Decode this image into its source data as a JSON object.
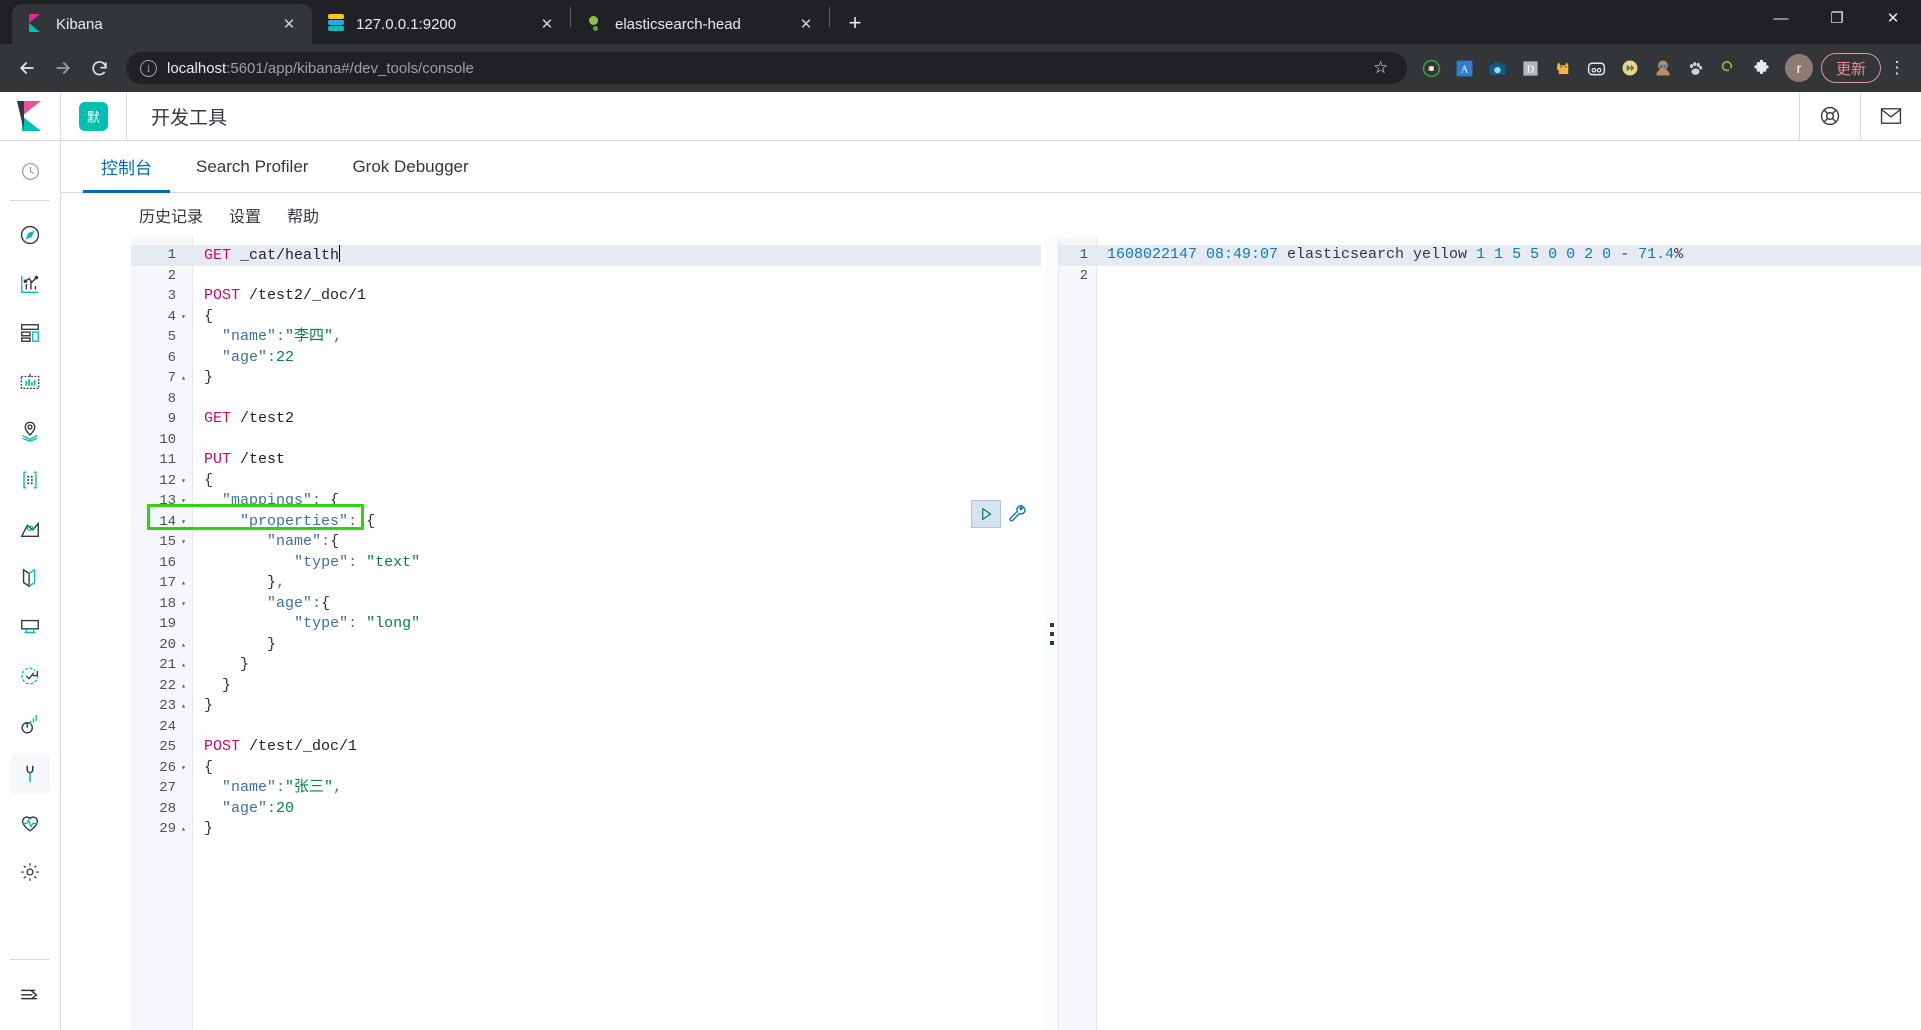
{
  "browser": {
    "tabs": [
      {
        "title": "Kibana",
        "favicon": "kibana-favicon",
        "active": true,
        "close_label": "✕"
      },
      {
        "title": "127.0.0.1:9200",
        "favicon": "elasticsearch-favicon",
        "active": false,
        "close_label": "✕"
      },
      {
        "title": "elasticsearch-head",
        "favicon": "elasticsearch-head-favicon",
        "active": false,
        "close_label": "✕"
      }
    ],
    "new_tab_label": "+",
    "window_controls": {
      "minimize": "—",
      "maximize": "❐",
      "close": "✕"
    },
    "nav": {
      "back": "←",
      "forward": "→",
      "reload": "⟳"
    },
    "omnibox": {
      "info_icon": "ⓘ",
      "url_host": "localhost",
      "url_rest": ":5601/app/kibana#/dev_tools/console",
      "star_icon": "☆"
    },
    "extensions": [
      {
        "name": "sync-extension-icon",
        "glyph": "⟳"
      },
      {
        "name": "a-translate-extension-icon",
        "glyph": "A"
      },
      {
        "name": "camera-screenshot-extension-icon",
        "glyph": "▣"
      },
      {
        "name": "d-extension-icon",
        "glyph": "D"
      },
      {
        "name": "cat-extension-icon",
        "glyph": "🐈"
      },
      {
        "name": "panda-extension-icon",
        "glyph": "◑"
      },
      {
        "name": "media-extension-icon",
        "glyph": "▷"
      },
      {
        "name": "person-extension-icon",
        "glyph": "●"
      },
      {
        "name": "paw-extension-icon",
        "glyph": "✣"
      },
      {
        "name": "magnifier-extension-icon",
        "glyph": "⚲"
      },
      {
        "name": "puzzle-extensions-icon",
        "glyph": "❖"
      }
    ],
    "profile_initial": "r",
    "update_button": "更新",
    "menu_icon": "⋮"
  },
  "kibana": {
    "logo_name": "kibana-logo",
    "space_chip": "默",
    "app_title": "开发工具",
    "header_icons": [
      {
        "name": "help-lifering-icon"
      },
      {
        "name": "mail-envelope-icon"
      }
    ],
    "nav_items": [
      {
        "name": "sidebar-item-recently-viewed",
        "icon": "clock-icon"
      },
      {
        "name": "sidebar-item-discover",
        "icon": "compass-icon"
      },
      {
        "name": "sidebar-item-visualize",
        "icon": "chart-icon"
      },
      {
        "name": "sidebar-item-dashboard",
        "icon": "dashboard-grid-icon"
      },
      {
        "name": "sidebar-item-canvas",
        "icon": "canvas-frame-icon"
      },
      {
        "name": "sidebar-item-maps",
        "icon": "map-marker-icon"
      },
      {
        "name": "sidebar-item-machine-learning",
        "icon": "ml-nodes-icon"
      },
      {
        "name": "sidebar-item-infrastructure",
        "icon": "infrastructure-icon"
      },
      {
        "name": "sidebar-item-logs",
        "icon": "logs-icon"
      },
      {
        "name": "sidebar-item-apm",
        "icon": "apm-icon"
      },
      {
        "name": "sidebar-item-uptime",
        "icon": "uptime-check-icon"
      },
      {
        "name": "sidebar-item-siem",
        "icon": "siem-radar-icon"
      },
      {
        "name": "sidebar-item-dev-tools",
        "icon": "wrench-icon",
        "selected": true
      },
      {
        "name": "sidebar-item-monitoring",
        "icon": "heartbeat-icon"
      },
      {
        "name": "sidebar-item-management",
        "icon": "gear-icon"
      }
    ],
    "collapse_icon": "collapse-arrow-icon",
    "tabs": [
      {
        "label": "控制台",
        "active": true
      },
      {
        "label": "Search Profiler",
        "active": false
      },
      {
        "label": "Grok Debugger",
        "active": false
      }
    ],
    "submenu": [
      {
        "label": "历史记录"
      },
      {
        "label": "设置"
      },
      {
        "label": "帮助"
      }
    ]
  },
  "console": {
    "play_icon": "play-triangle-icon",
    "wrench_icon": "wrench-settings-icon",
    "drag_handle": "pane-drag-handle",
    "editor_lines": [
      {
        "n": "1",
        "fold": "",
        "highlight": true,
        "tokens": [
          {
            "t": "GET",
            "c": "m"
          },
          {
            "t": " _cat/health",
            "c": "u"
          }
        ]
      },
      {
        "n": "2",
        "fold": "",
        "tokens": []
      },
      {
        "n": "3",
        "fold": "",
        "tokens": [
          {
            "t": "POST",
            "c": "m"
          },
          {
            "t": " /test2/_doc/1",
            "c": "u"
          }
        ]
      },
      {
        "n": "4",
        "fold": "▾",
        "tokens": [
          {
            "t": "{",
            "c": "p"
          }
        ]
      },
      {
        "n": "5",
        "fold": "",
        "tokens": [
          {
            "t": "  ",
            "c": "p"
          },
          {
            "t": "\"name\"",
            "c": "k"
          },
          {
            "t": ":",
            "c": "k"
          },
          {
            "t": "\"李四\"",
            "c": "s"
          },
          {
            "t": ",",
            "c": "k"
          }
        ]
      },
      {
        "n": "6",
        "fold": "",
        "tokens": [
          {
            "t": "  ",
            "c": "p"
          },
          {
            "t": "\"age\"",
            "c": "k"
          },
          {
            "t": ":",
            "c": "k"
          },
          {
            "t": "22",
            "c": "n"
          }
        ]
      },
      {
        "n": "7",
        "fold": "▴",
        "tokens": [
          {
            "t": "}",
            "c": "p"
          }
        ]
      },
      {
        "n": "8",
        "fold": "",
        "tokens": []
      },
      {
        "n": "9",
        "fold": "",
        "tokens": [
          {
            "t": "GET",
            "c": "m"
          },
          {
            "t": " /test2",
            "c": "u"
          }
        ]
      },
      {
        "n": "10",
        "fold": "",
        "tokens": []
      },
      {
        "n": "11",
        "fold": "",
        "tokens": [
          {
            "t": "PUT",
            "c": "m"
          },
          {
            "t": " /test",
            "c": "u"
          }
        ]
      },
      {
        "n": "12",
        "fold": "▾",
        "tokens": [
          {
            "t": "{",
            "c": "p"
          }
        ]
      },
      {
        "n": "13",
        "fold": "▾",
        "tokens": [
          {
            "t": "  ",
            "c": "p"
          },
          {
            "t": "\"mappings\"",
            "c": "k"
          },
          {
            "t": ": ",
            "c": "k"
          },
          {
            "t": "{",
            "c": "p"
          }
        ]
      },
      {
        "n": "14",
        "fold": "▾",
        "tokens": [
          {
            "t": "   ",
            "c": "guide"
          },
          {
            "t": " ",
            "c": "p"
          },
          {
            "t": "\"properties\"",
            "c": "k"
          },
          {
            "t": ": ",
            "c": "k"
          },
          {
            "t": "{",
            "c": "p"
          }
        ]
      },
      {
        "n": "15",
        "fold": "▾",
        "tokens": [
          {
            "t": "   ",
            "c": "guide"
          },
          {
            "t": "   ",
            "c": "guide"
          },
          {
            "t": " ",
            "c": "p"
          },
          {
            "t": "\"name\"",
            "c": "k"
          },
          {
            "t": ":",
            "c": "k"
          },
          {
            "t": "{",
            "c": "p"
          }
        ]
      },
      {
        "n": "16",
        "fold": "",
        "tokens": [
          {
            "t": "   ",
            "c": "guide"
          },
          {
            "t": "   ",
            "c": "guide"
          },
          {
            "t": "   ",
            "c": "guide"
          },
          {
            "t": " ",
            "c": "p"
          },
          {
            "t": "\"type\"",
            "c": "k"
          },
          {
            "t": ": ",
            "c": "k"
          },
          {
            "t": "\"text\"",
            "c": "s"
          }
        ]
      },
      {
        "n": "17",
        "fold": "▴",
        "tokens": [
          {
            "t": "   ",
            "c": "guide"
          },
          {
            "t": "   ",
            "c": "guide"
          },
          {
            "t": " ",
            "c": "p"
          },
          {
            "t": "}",
            "c": "p"
          },
          {
            "t": ",",
            "c": "k"
          }
        ]
      },
      {
        "n": "18",
        "fold": "▾",
        "tokens": [
          {
            "t": "   ",
            "c": "guide"
          },
          {
            "t": "   ",
            "c": "guide"
          },
          {
            "t": " ",
            "c": "p"
          },
          {
            "t": "\"age\"",
            "c": "k"
          },
          {
            "t": ":",
            "c": "k"
          },
          {
            "t": "{",
            "c": "p"
          }
        ]
      },
      {
        "n": "19",
        "fold": "",
        "tokens": [
          {
            "t": "   ",
            "c": "guide"
          },
          {
            "t": "   ",
            "c": "guide"
          },
          {
            "t": "   ",
            "c": "guide"
          },
          {
            "t": " ",
            "c": "p"
          },
          {
            "t": "\"type\"",
            "c": "k"
          },
          {
            "t": ": ",
            "c": "k"
          },
          {
            "t": "\"long\"",
            "c": "s"
          }
        ]
      },
      {
        "n": "20",
        "fold": "▴",
        "tokens": [
          {
            "t": "   ",
            "c": "guide"
          },
          {
            "t": "   ",
            "c": "guide"
          },
          {
            "t": " ",
            "c": "p"
          },
          {
            "t": "}",
            "c": "p"
          }
        ]
      },
      {
        "n": "21",
        "fold": "▴",
        "tokens": [
          {
            "t": "   ",
            "c": "guide"
          },
          {
            "t": " ",
            "c": "p"
          },
          {
            "t": "}",
            "c": "p"
          }
        ]
      },
      {
        "n": "22",
        "fold": "▴",
        "tokens": [
          {
            "t": "  ",
            "c": "p"
          },
          {
            "t": "}",
            "c": "p"
          }
        ]
      },
      {
        "n": "23",
        "fold": "▴",
        "tokens": [
          {
            "t": "}",
            "c": "p"
          }
        ]
      },
      {
        "n": "24",
        "fold": "",
        "tokens": []
      },
      {
        "n": "25",
        "fold": "",
        "tokens": [
          {
            "t": "POST",
            "c": "m"
          },
          {
            "t": " /test/_doc/1",
            "c": "u"
          }
        ]
      },
      {
        "n": "26",
        "fold": "▾",
        "tokens": [
          {
            "t": "{",
            "c": "p"
          }
        ]
      },
      {
        "n": "27",
        "fold": "",
        "tokens": [
          {
            "t": "  ",
            "c": "p"
          },
          {
            "t": "\"name\"",
            "c": "k"
          },
          {
            "t": ":",
            "c": "k"
          },
          {
            "t": "\"张三\"",
            "c": "s"
          },
          {
            "t": ",",
            "c": "k"
          }
        ]
      },
      {
        "n": "28",
        "fold": "",
        "tokens": [
          {
            "t": "  ",
            "c": "p"
          },
          {
            "t": "\"age\"",
            "c": "k"
          },
          {
            "t": ":",
            "c": "k"
          },
          {
            "t": "20",
            "c": "n"
          }
        ]
      },
      {
        "n": "29",
        "fold": "▴",
        "tokens": [
          {
            "t": "}",
            "c": "p"
          }
        ]
      }
    ],
    "output_lines": [
      {
        "n": "1",
        "highlight": true,
        "tokens": [
          {
            "t": "1608022147",
            "c": "onum"
          },
          {
            "t": " 08:49:07",
            "c": "onum"
          },
          {
            "t": " elasticsearch yellow ",
            "c": "otxt"
          },
          {
            "t": "1 1 5 5 0 0 2 0",
            "c": "onum"
          },
          {
            "t": " - ",
            "c": "otxt"
          },
          {
            "t": "71.4",
            "c": "onum"
          },
          {
            "t": "%",
            "c": "otxt"
          }
        ]
      },
      {
        "n": "2",
        "tokens": []
      }
    ]
  },
  "colors": {
    "kibana_accent": "#006bb4",
    "kibana_teal": "#00bfb3",
    "kibana_pink": "#f04e98",
    "highlight_green": "#2fd411",
    "chrome_dark": "#202124",
    "chrome_toolbar": "#323639"
  }
}
